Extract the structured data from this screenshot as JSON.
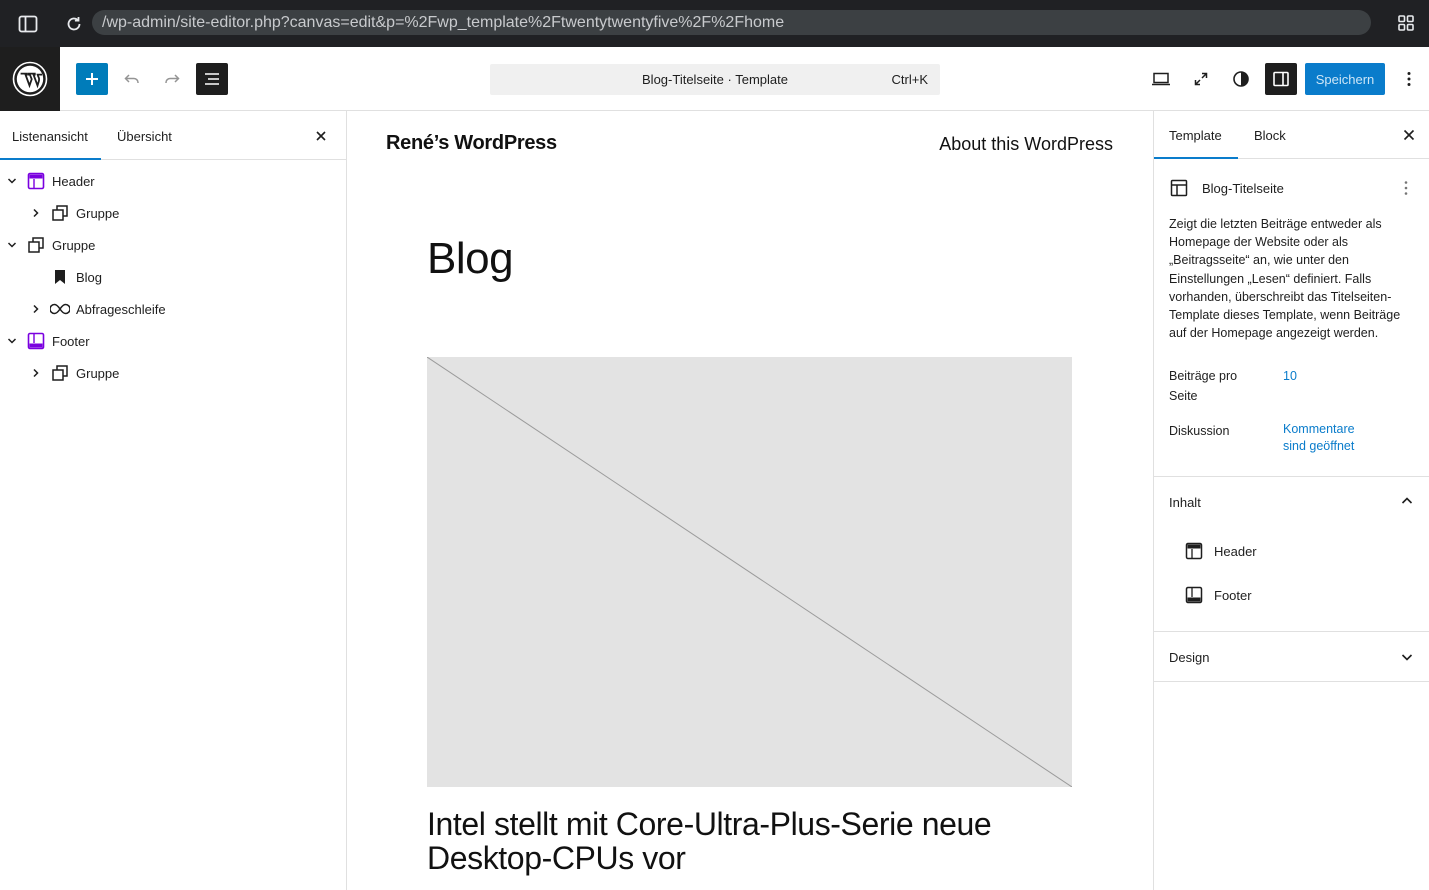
{
  "browser": {
    "url": "/wp-admin/site-editor.php?canvas=edit&p=%2Fwp_template%2Ftwentytwentyfive%2F%2Fhome"
  },
  "header": {
    "command_title": "Blog-Titelseite · Template",
    "command_shortcut": "Ctrl+K",
    "save_label": "Speichern"
  },
  "left_panel": {
    "tabs": [
      "Listenansicht",
      "Übersicht"
    ],
    "tree": [
      {
        "label": "Header",
        "icon": "template-part-header-icon",
        "expanded": true
      },
      {
        "label": "Gruppe",
        "icon": "group-icon",
        "expanded": false
      },
      {
        "label": "Gruppe",
        "icon": "group-icon",
        "expanded": true
      },
      {
        "label": "Blog",
        "icon": "bookmark-icon"
      },
      {
        "label": "Abfrageschleife",
        "icon": "loop-icon",
        "expanded": false
      },
      {
        "label": "Footer",
        "icon": "template-part-footer-icon",
        "expanded": true
      },
      {
        "label": "Gruppe",
        "icon": "group-icon",
        "expanded": false
      }
    ]
  },
  "canvas": {
    "site_title": "René’s WordPress",
    "nav_link": "About this WordPress",
    "heading": "Blog",
    "post_title": "Intel stellt mit Core-Ultra-Plus-Serie neue Desktop-CPUs vor"
  },
  "right_panel": {
    "tabs": [
      "Template",
      "Block"
    ],
    "template_name": "Blog-Titelseite",
    "description": "Zeigt die letzten Beiträge entweder als Homepage der Website oder als „Beitragsseite“ an, wie unter den Einstellungen „Lesen“ definiert. Falls vorhanden, überschreibt das Titelseiten-Template dieses Template, wenn Beiträge auf der Homepage angezeigt werden.",
    "posts_per_page_label": "Beiträge pro Seite",
    "posts_per_page_value": "10",
    "discussion_label": "Diskussion",
    "discussion_value": "Kommentare sind geöffnet",
    "content_title": "Inhalt",
    "content_items": [
      "Header",
      "Footer"
    ],
    "design_title": "Design"
  },
  "colors": {
    "accent": "#0a7ccb",
    "template_part": "#7a00df",
    "dark": "#1e1e1e"
  }
}
